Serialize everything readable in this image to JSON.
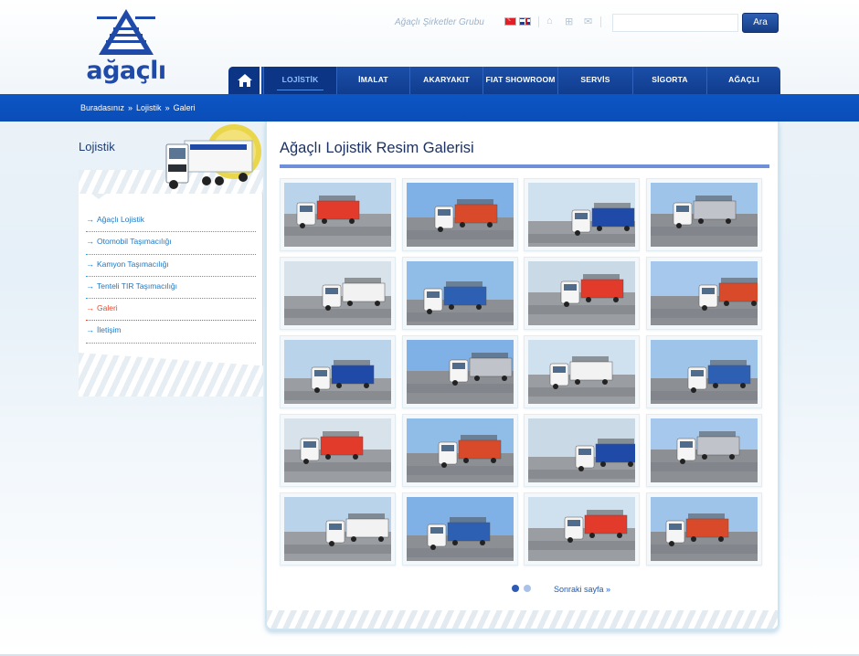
{
  "header": {
    "logo_text": "ağaçlı",
    "group_link": "Ağaçlı Şirketler Grubu",
    "flags": [
      "tr-flag-icon",
      "en-flag-icon"
    ],
    "util_icons": [
      "home-icon",
      "sitemap-icon",
      "mail-icon"
    ],
    "search": {
      "placeholder": "",
      "button_label": "Ara"
    }
  },
  "nav": {
    "home_icon": "home-icon",
    "items": [
      {
        "label": "LOJİSTİK",
        "active": true
      },
      {
        "label": "İMALAT"
      },
      {
        "label": "AKARYAKIT"
      },
      {
        "label": "FIAT SHOWROOM"
      },
      {
        "label": "SERVİS"
      },
      {
        "label": "SİGORTA"
      },
      {
        "label": "AĞAÇLI"
      }
    ]
  },
  "breadcrumb": {
    "items": [
      "Buradasınız",
      "Lojistik",
      "Galeri"
    ],
    "separator": "»"
  },
  "sidebar": {
    "title": "Lojistik",
    "items": [
      {
        "label": "Ağaçlı Lojistik"
      },
      {
        "label": "Otomobil Taşımacılığı"
      },
      {
        "label": "Kamyon Taşımacılığı"
      },
      {
        "label": "Tenteli TIR Taşımacılığı"
      },
      {
        "label": "Galeri",
        "active": true
      },
      {
        "label": "İletişim"
      }
    ]
  },
  "main": {
    "title": "Ağaçlı Lojistik Resim Galerisi",
    "gallery_count": 20,
    "pager": {
      "pages": 2,
      "current": 1,
      "next_label": "Sonraki sayfa »"
    }
  },
  "colors": {
    "brand_blue": "#1f4aa8",
    "nav_blue": "#0f3c8e",
    "crumb_blue": "#0a4db8",
    "link_blue": "#1f77c4",
    "active_red": "#e8452c"
  }
}
